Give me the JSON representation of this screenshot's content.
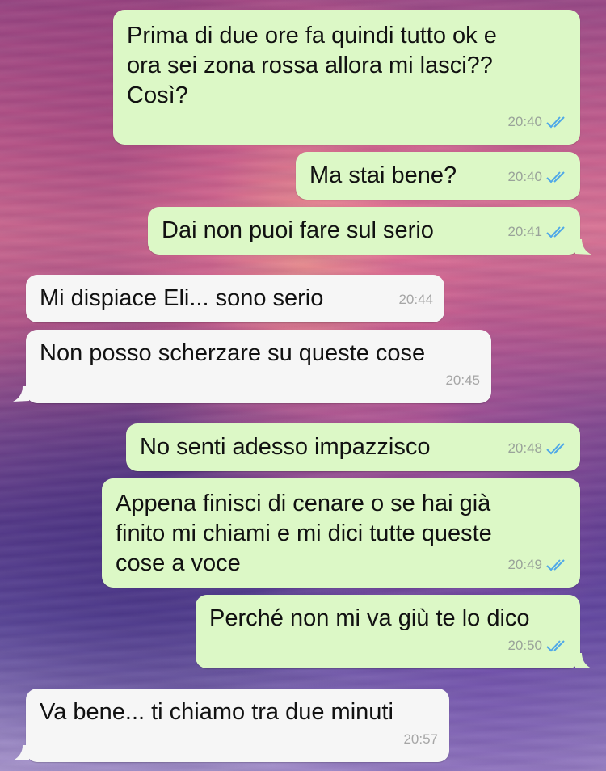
{
  "chat": {
    "messages": [
      {
        "direction": "out",
        "text": "Prima di due ore fa quindi tutto ok e\nora sei zona rossa allora mi lasci??\nCosì?",
        "time": "20:40",
        "status": "read"
      },
      {
        "direction": "out",
        "text": "Ma stai bene?",
        "time": "20:40",
        "status": "read"
      },
      {
        "direction": "out",
        "text": "Dai non puoi fare sul serio",
        "time": "20:41",
        "status": "read"
      },
      {
        "direction": "in",
        "text": "Mi dispiace Eli... sono serio",
        "time": "20:44"
      },
      {
        "direction": "in",
        "text": "Non posso scherzare su queste cose",
        "time": "20:45"
      },
      {
        "direction": "out",
        "text": "No senti adesso impazzisco",
        "time": "20:48",
        "status": "read"
      },
      {
        "direction": "out",
        "text": "Appena finisci di cenare o se hai già\nfinito mi chiami e mi dici tutte queste\ncose a voce",
        "time": "20:49",
        "status": "read"
      },
      {
        "direction": "out",
        "text": "Perché non mi va giù te lo dico",
        "time": "20:50",
        "status": "read"
      },
      {
        "direction": "in",
        "text": "Va bene... ti chiamo tra due minuti",
        "time": "20:57"
      }
    ]
  },
  "colors": {
    "outgoing_bubble": "#dcf8c6",
    "incoming_bubble": "#f6f6f6",
    "read_tick": "#4fa8e8",
    "timestamp": "#9aa39a"
  },
  "icons": {
    "read_status": "double-check-icon"
  }
}
